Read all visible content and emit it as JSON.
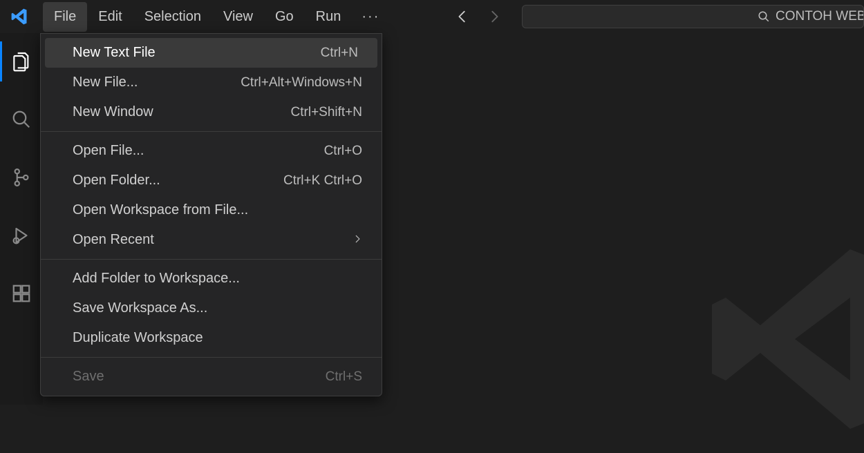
{
  "menubar": {
    "items": [
      "File",
      "Edit",
      "Selection",
      "View",
      "Go",
      "Run"
    ],
    "open_index": 0,
    "overflow": "···"
  },
  "search": {
    "text": "CONTOH WEBS"
  },
  "activitybar": {
    "items": [
      {
        "name": "explorer-icon",
        "active": true
      },
      {
        "name": "search-icon",
        "active": false
      },
      {
        "name": "source-control-icon",
        "active": false
      },
      {
        "name": "run-debug-icon",
        "active": false
      },
      {
        "name": "extensions-icon",
        "active": false
      }
    ]
  },
  "file_menu": {
    "groups": [
      [
        {
          "label": "New Text File",
          "shortcut": "Ctrl+N",
          "highlight": true
        },
        {
          "label": "New File...",
          "shortcut": "Ctrl+Alt+Windows+N"
        },
        {
          "label": "New Window",
          "shortcut": "Ctrl+Shift+N"
        }
      ],
      [
        {
          "label": "Open File...",
          "shortcut": "Ctrl+O"
        },
        {
          "label": "Open Folder...",
          "shortcut": "Ctrl+K Ctrl+O"
        },
        {
          "label": "Open Workspace from File...",
          "shortcut": ""
        },
        {
          "label": "Open Recent",
          "shortcut": "",
          "submenu": true
        }
      ],
      [
        {
          "label": "Add Folder to Workspace...",
          "shortcut": ""
        },
        {
          "label": "Save Workspace As...",
          "shortcut": ""
        },
        {
          "label": "Duplicate Workspace",
          "shortcut": ""
        }
      ],
      [
        {
          "label": "Save",
          "shortcut": "Ctrl+S",
          "disabled": true
        }
      ]
    ]
  }
}
